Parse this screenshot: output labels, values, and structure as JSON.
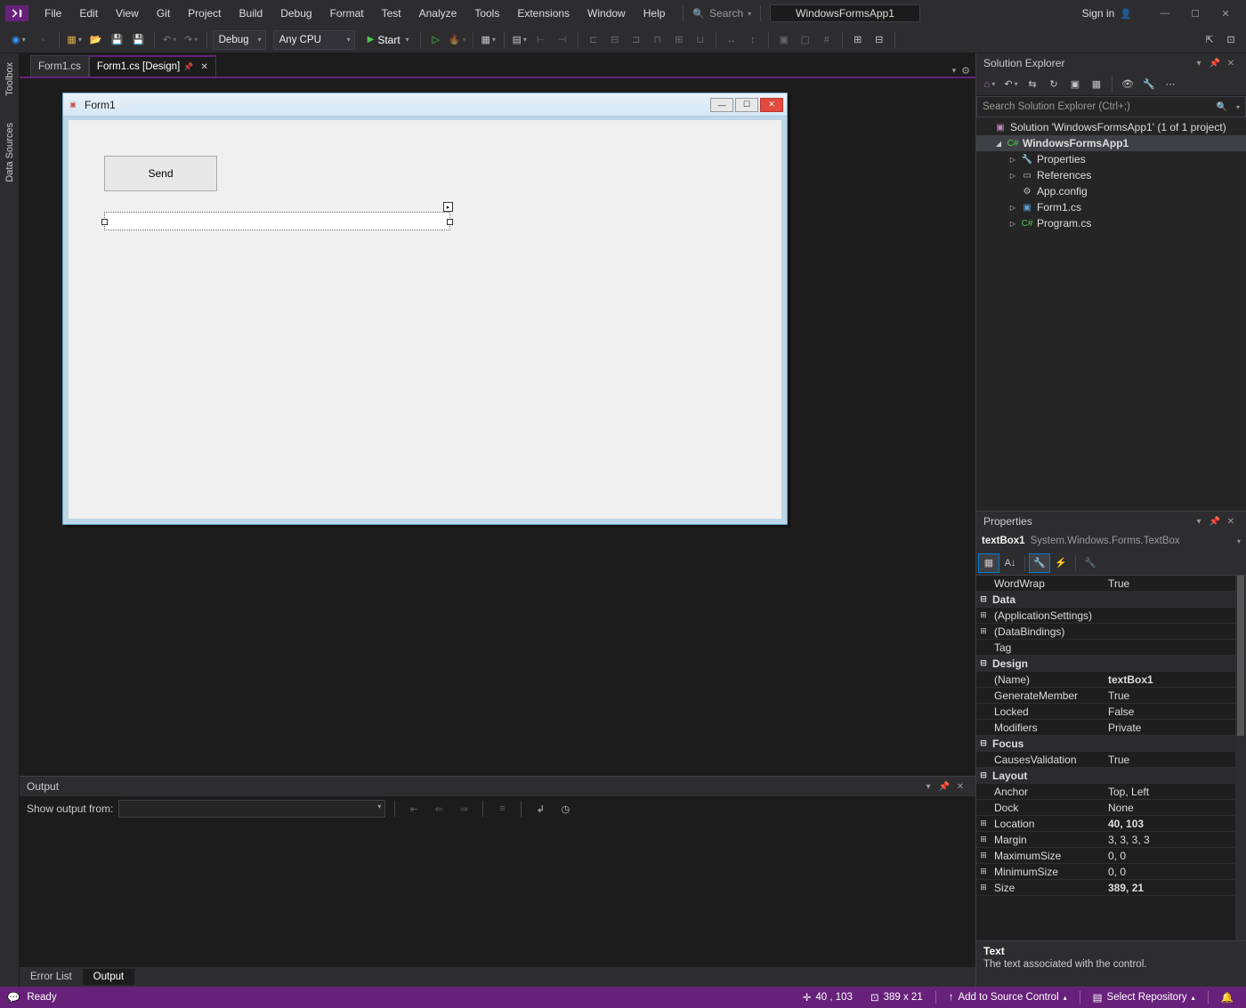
{
  "menu": {
    "items": [
      "File",
      "Edit",
      "View",
      "Git",
      "Project",
      "Build",
      "Debug",
      "Format",
      "Test",
      "Analyze",
      "Tools",
      "Extensions",
      "Window",
      "Help"
    ],
    "searchLabel": "Search",
    "projectName": "WindowsFormsApp1",
    "signIn": "Sign in"
  },
  "toolbar": {
    "config": "Debug",
    "platform": "Any CPU",
    "startLabel": "Start"
  },
  "leftTabs": {
    "toolbox": "Toolbox",
    "dataSources": "Data Sources"
  },
  "docTabs": {
    "tab1": "Form1.cs",
    "tab2": "Form1.cs [Design]"
  },
  "designer": {
    "formTitle": "Form1",
    "buttonText": "Send"
  },
  "solutionExplorer": {
    "title": "Solution Explorer",
    "searchPlaceholder": "Search Solution Explorer (Ctrl+;)",
    "solution": "Solution 'WindowsFormsApp1' (1 of 1 project)",
    "project": "WindowsFormsApp1",
    "properties": "Properties",
    "references": "References",
    "appConfig": "App.config",
    "form1": "Form1.cs",
    "program": "Program.cs"
  },
  "properties": {
    "title": "Properties",
    "objName": "textBox1",
    "objType": "System.Windows.Forms.TextBox",
    "rows": [
      {
        "k": "WordWrap",
        "v": "True",
        "cat": false,
        "exp": "",
        "indent": true
      },
      {
        "k": "Data",
        "v": "",
        "cat": true,
        "exp": "⊟"
      },
      {
        "k": "(ApplicationSettings)",
        "v": "",
        "cat": false,
        "exp": "⊞",
        "indent": true
      },
      {
        "k": "(DataBindings)",
        "v": "",
        "cat": false,
        "exp": "⊞",
        "indent": true
      },
      {
        "k": "Tag",
        "v": "",
        "cat": false,
        "exp": "",
        "indent": true
      },
      {
        "k": "Design",
        "v": "",
        "cat": true,
        "exp": "⊟"
      },
      {
        "k": "(Name)",
        "v": "textBox1",
        "cat": false,
        "exp": "",
        "indent": true,
        "bold": true
      },
      {
        "k": "GenerateMember",
        "v": "True",
        "cat": false,
        "exp": "",
        "indent": true
      },
      {
        "k": "Locked",
        "v": "False",
        "cat": false,
        "exp": "",
        "indent": true
      },
      {
        "k": "Modifiers",
        "v": "Private",
        "cat": false,
        "exp": "",
        "indent": true
      },
      {
        "k": "Focus",
        "v": "",
        "cat": true,
        "exp": "⊟"
      },
      {
        "k": "CausesValidation",
        "v": "True",
        "cat": false,
        "exp": "",
        "indent": true
      },
      {
        "k": "Layout",
        "v": "",
        "cat": true,
        "exp": "⊟"
      },
      {
        "k": "Anchor",
        "v": "Top, Left",
        "cat": false,
        "exp": "",
        "indent": true
      },
      {
        "k": "Dock",
        "v": "None",
        "cat": false,
        "exp": "",
        "indent": true
      },
      {
        "k": "Location",
        "v": "40, 103",
        "cat": false,
        "exp": "⊞",
        "indent": true,
        "bold": true
      },
      {
        "k": "Margin",
        "v": "3, 3, 3, 3",
        "cat": false,
        "exp": "⊞",
        "indent": true
      },
      {
        "k": "MaximumSize",
        "v": "0, 0",
        "cat": false,
        "exp": "⊞",
        "indent": true
      },
      {
        "k": "MinimumSize",
        "v": "0, 0",
        "cat": false,
        "exp": "⊞",
        "indent": true
      },
      {
        "k": "Size",
        "v": "389, 21",
        "cat": false,
        "exp": "⊞",
        "indent": true,
        "bold": true
      }
    ],
    "descTitle": "Text",
    "descText": "The text associated with the control."
  },
  "output": {
    "title": "Output",
    "showFrom": "Show output from:",
    "tabErrorList": "Error List",
    "tabOutput": "Output"
  },
  "statusbar": {
    "ready": "Ready",
    "pos": "40 , 103",
    "size": "389 x 21",
    "addSource": "Add to Source Control",
    "selectRepo": "Select Repository"
  }
}
